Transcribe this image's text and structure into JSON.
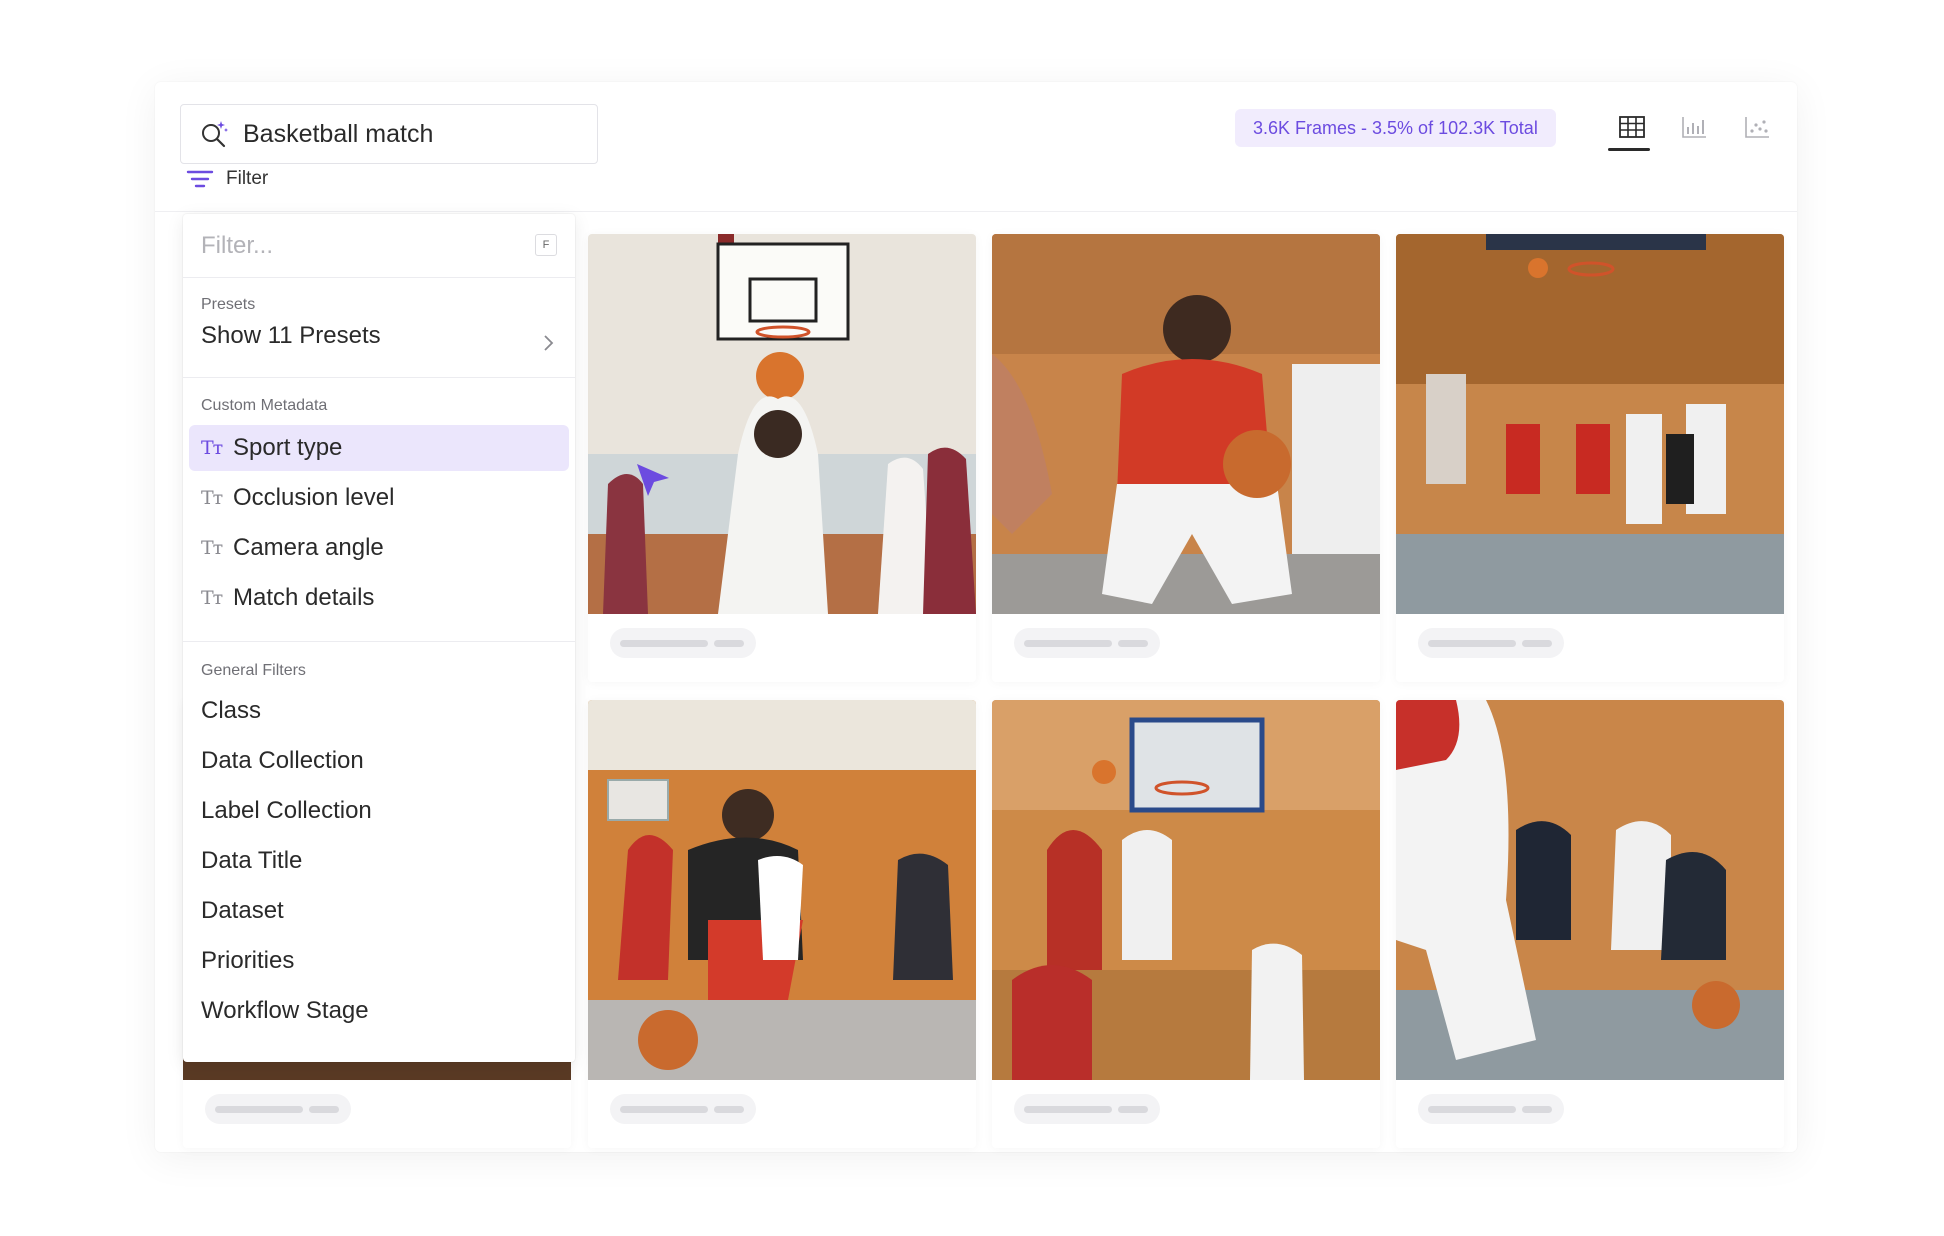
{
  "search": {
    "query": "Basketball match",
    "icon": "ai-search-icon"
  },
  "filter_toggle": {
    "label": "Filter",
    "icon": "filter-lines-icon"
  },
  "frames_badge": "3.6K Frames - 3.5% of 102.3K Total",
  "view_modes": [
    {
      "name": "grid-view",
      "icon": "table-grid-icon",
      "active": true
    },
    {
      "name": "bar-view",
      "icon": "bar-chart-icon",
      "active": false
    },
    {
      "name": "scatter-view",
      "icon": "scatter-plot-icon",
      "active": false
    }
  ],
  "filter_panel": {
    "placeholder": "Filter...",
    "shortcut": "F",
    "presets": {
      "label": "Presets",
      "action": "Show 11 Presets"
    },
    "custom_metadata": {
      "label": "Custom Metadata",
      "items": [
        "Sport type",
        "Occlusion level",
        "Camera angle",
        "Match details"
      ],
      "active_index": 0
    },
    "general_filters": {
      "label": "General Filters",
      "items": [
        "Class",
        "Data Collection",
        "Label Collection",
        "Data Title",
        "Dataset",
        "Priorities",
        "Workflow Stage"
      ]
    }
  },
  "colors": {
    "accent": "#6c4be0",
    "accent_bg": "#ebe6fc",
    "badge_bg": "#f1ecfd"
  },
  "cards": [
    {
      "alt": "basketball-hoop-shot"
    },
    {
      "alt": "player-holding-ball"
    },
    {
      "alt": "players-jumping-gym"
    },
    {
      "alt": "player-dribbling-defense"
    },
    {
      "alt": "players-at-hoop"
    },
    {
      "alt": "players-on-court"
    }
  ]
}
